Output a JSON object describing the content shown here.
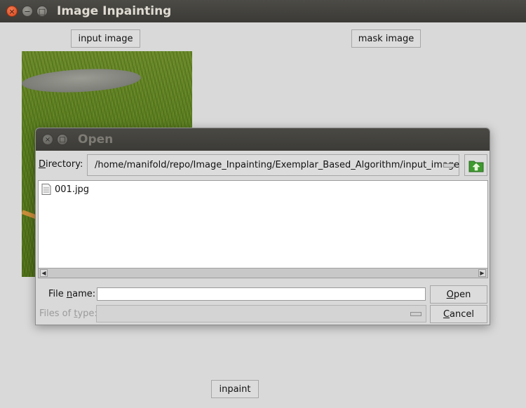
{
  "window": {
    "title": "Image Inpainting",
    "controls": {
      "close": "×",
      "minimize": "−",
      "maximize": "□"
    }
  },
  "main": {
    "input_image_label": "input image",
    "mask_image_label": "mask image",
    "inpaint_label": "inpaint"
  },
  "dialog": {
    "title": "Open",
    "directory_label_first": "D",
    "directory_label_rest": "irectory:",
    "directory_value": "/home/manifold/repo/Image_Inpainting/Exemplar_Based_Algorithm/input_image",
    "files": [
      {
        "name": "001.jpg"
      }
    ],
    "file_name_label_pre": "File ",
    "file_name_label_u": "n",
    "file_name_label_post": "ame:",
    "file_name_value": "",
    "files_of_type_pre": "Files of ",
    "files_of_type_u": "t",
    "files_of_type_post": "ype:",
    "files_of_type_value": "",
    "open_first": "O",
    "open_rest": "pen",
    "cancel_first": "C",
    "cancel_rest": "ancel"
  },
  "colors": {
    "titlebar": "#3c3b37",
    "close_button": "#e95420",
    "background": "#d9d9d9"
  }
}
